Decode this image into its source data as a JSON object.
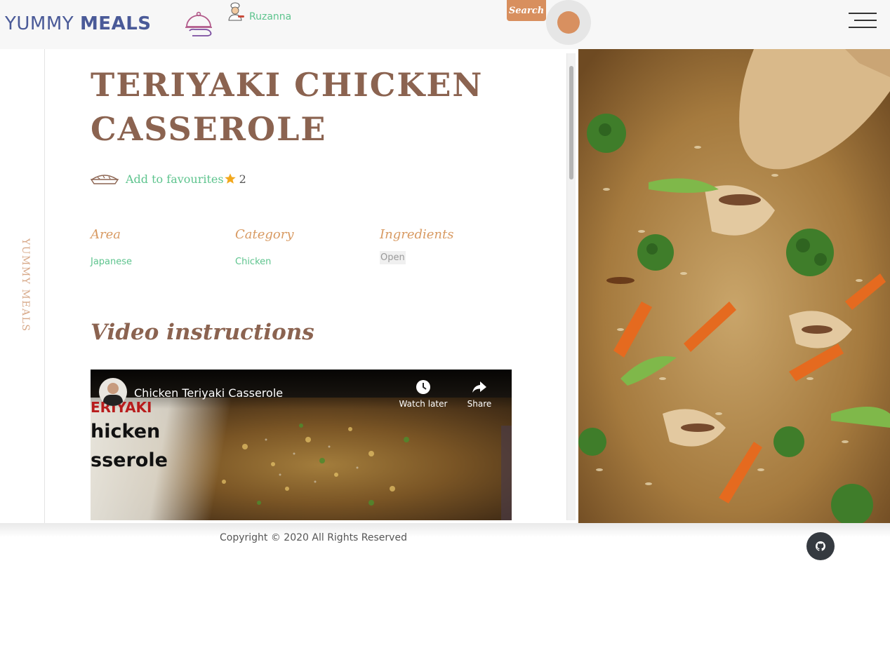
{
  "header": {
    "logo_word1": "YUMMY",
    "logo_word2": "MEALS",
    "username": "Ruzanna",
    "search_label": "Search",
    "icons": [
      "cloche-icon",
      "chef-avatar-icon",
      "search-toggle-icon",
      "hamburger-menu-icon"
    ]
  },
  "side_rail": {
    "text": "YUMMY MEALS"
  },
  "recipe": {
    "title": "TERIYAKI CHICKEN CASSEROLE",
    "favourite_label": "Add to favourites",
    "favourite_count": "2",
    "area_label": "Area",
    "area_value": "Japanese",
    "category_label": "Category",
    "category_value": "Chicken",
    "ingredients_label": "Ingredients",
    "ingredients_button": "Open",
    "video_heading": "Video instructions"
  },
  "video": {
    "title": "Chicken Teriyaki Casserole",
    "watch_later": "Watch later",
    "share": "Share",
    "overlay_lines": [
      "ERIYAKI",
      "hicken",
      "sserole"
    ]
  },
  "footer": {
    "copyright": "Copyright © 2020 All Rights Reserved",
    "github_icon": "github-icon"
  },
  "colors": {
    "brand_blue": "#4a5a98",
    "title_brown": "#8b6350",
    "accent_orange": "#d88f5e",
    "link_green": "#5ec48e",
    "footer_button": "#353a40"
  }
}
